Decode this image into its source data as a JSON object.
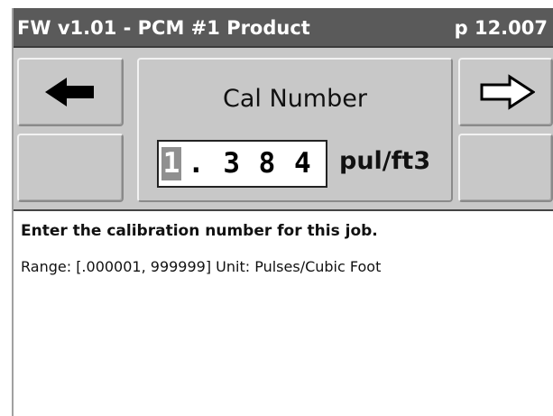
{
  "header": {
    "title": "FW v1.01 - PCM #1 Product",
    "page": "p 12.007"
  },
  "field": {
    "label": "Cal Number",
    "cursor_digit": "1",
    "value_rest": ". 3 8 4",
    "unit": "pul/ft3"
  },
  "info": {
    "heading": "Enter the calibration number for this job.",
    "range_text": "Range: [.000001, 999999]  Unit: Pulses/Cubic Foot"
  },
  "icons": {
    "back": "arrow-left-solid-icon",
    "next": "arrow-right-outline-icon"
  },
  "colors": {
    "titlebar": "#5a5a5a",
    "panel": "#c8c8c8",
    "cursor": "#909090"
  }
}
